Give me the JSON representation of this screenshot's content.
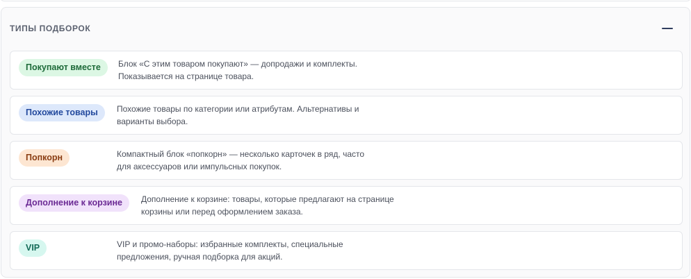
{
  "section": {
    "title": "ТИПЫ ПОДБОРОК",
    "collapse_icon": "minus-icon"
  },
  "types": [
    {
      "label": "Покупают вместе",
      "badge_bg": "#dcf7e4",
      "badge_fg": "#1e6b3a",
      "line1": "Блок «С этим товаром покупают» — допродажи и комплекты.",
      "line2": "Показывается на странице товара."
    },
    {
      "label": "Похожие товары",
      "badge_bg": "#dde8fb",
      "badge_fg": "#244a9e",
      "line1": "Похожие товары по категории или атрибутам. Альтернативы и",
      "line2": "варианты выбора."
    },
    {
      "label": "Попкорн",
      "badge_bg": "#fde6d2",
      "badge_fg": "#8a3d12",
      "line1": "Компактный блок «попкорн» — несколько карточек в ряд, часто",
      "line2": "для аксессуаров или импульсных покупок."
    },
    {
      "label": "Дополнение к корзине",
      "badge_bg": "#f1e2fb",
      "badge_fg": "#6b2a94",
      "line1": "Дополнение к корзине: товары, которые предлагают на странице",
      "line2": "корзины или перед оформлением заказа."
    },
    {
      "label": "VIP",
      "badge_bg": "#d6f7ef",
      "badge_fg": "#146b58",
      "line1": "VIP и промо-наборы: избранные комплекты, специальные",
      "line2": "предложения, ручная подборка для акций."
    }
  ]
}
